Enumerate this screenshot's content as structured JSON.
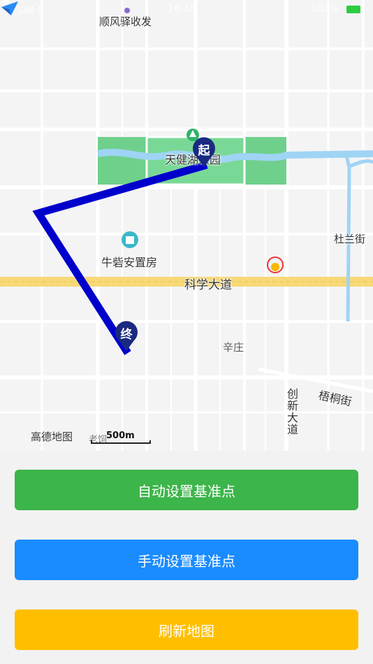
{
  "status_bar": {
    "carrier": "无SIM卡",
    "time": "16:35",
    "battery_text": "100%",
    "battery_color": "#2ecc40"
  },
  "map": {
    "labels": {
      "top_place": "顺风驿收发",
      "park": "天健湖公园",
      "housing": "牛砦安置房",
      "road_main": "科学大道",
      "road_dulan": "杜兰街",
      "village": "辛庄",
      "road_wutong": "梧桐街",
      "road_chuangxin": "创新大道",
      "bottom_place": "老饲"
    },
    "route": {
      "start_marker": "起",
      "end_marker": "终",
      "color": "#0000cc"
    },
    "attribution": "高德地图",
    "scale": "500m"
  },
  "buttons": {
    "auto_set": {
      "label": "自动设置基准点",
      "color": "#3cb54a"
    },
    "manual_set": {
      "label": "手动设置基准点",
      "color": "#1a8cff"
    },
    "refresh": {
      "label": "刷新地图",
      "color": "#ffbf00"
    }
  }
}
